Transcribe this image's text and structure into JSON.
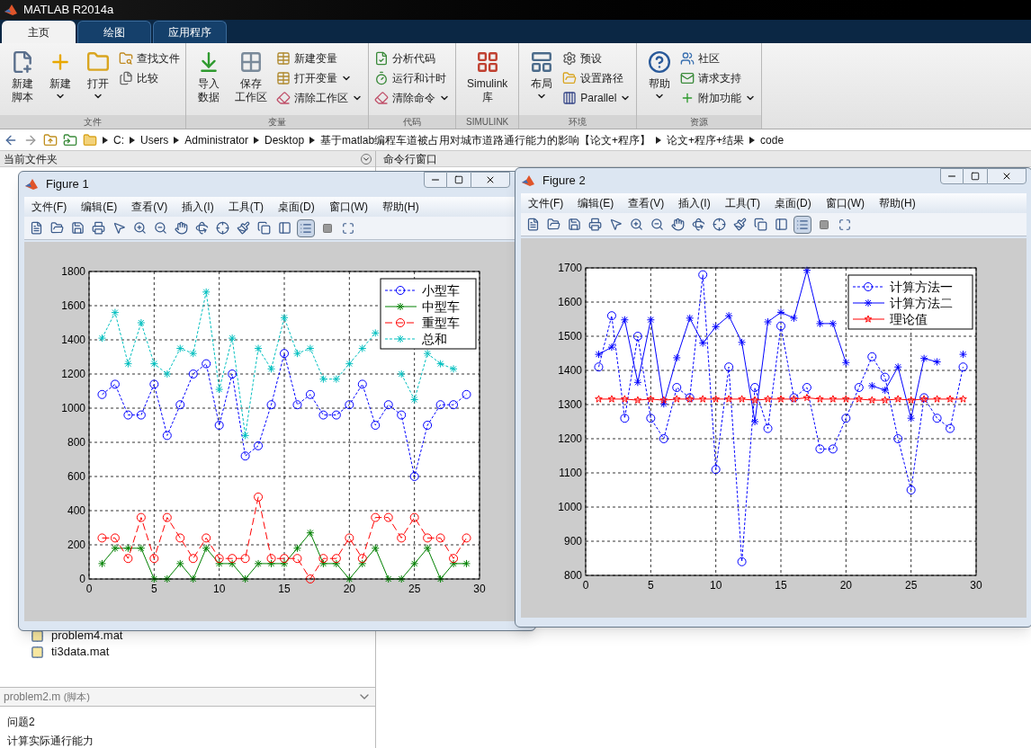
{
  "window": {
    "title": "MATLAB R2014a"
  },
  "ribbon_tabs": [
    {
      "label": "主页",
      "selected": true
    },
    {
      "label": "绘图",
      "selected": false
    },
    {
      "label": "应用程序",
      "selected": false
    }
  ],
  "ribbon_groups": [
    {
      "label": "文件",
      "items": [
        {
          "kind": "large",
          "lines": [
            "新建",
            "脚本"
          ],
          "dropdown": false
        },
        {
          "kind": "large",
          "lines": [
            "新建"
          ],
          "dropdown": true
        },
        {
          "kind": "large",
          "lines": [
            "打开"
          ],
          "dropdown": true
        },
        {
          "kind": "small",
          "lines": [
            "查找文件"
          ],
          "dropdown": false
        },
        {
          "kind": "small",
          "lines": [
            "比较"
          ],
          "dropdown": false
        }
      ]
    },
    {
      "label": "变量",
      "items": [
        {
          "kind": "large",
          "lines": [
            "导入",
            "数据"
          ],
          "dropdown": false
        },
        {
          "kind": "large",
          "lines": [
            "保存",
            "工作区"
          ],
          "dropdown": false
        },
        {
          "kind": "small",
          "lines": [
            "新建变量"
          ],
          "dropdown": false
        },
        {
          "kind": "small",
          "lines": [
            "打开变量"
          ],
          "dropdown": true
        },
        {
          "kind": "small",
          "lines": [
            "清除工作区"
          ],
          "dropdown": true
        }
      ]
    },
    {
      "label": "代码",
      "items": [
        {
          "kind": "small",
          "lines": [
            "分析代码"
          ],
          "dropdown": false
        },
        {
          "kind": "small",
          "lines": [
            "运行和计时"
          ],
          "dropdown": false
        },
        {
          "kind": "small",
          "lines": [
            "清除命令"
          ],
          "dropdown": true
        }
      ]
    },
    {
      "label": "SIMULINK",
      "items": [
        {
          "kind": "large",
          "lines": [
            "Simulink",
            "库"
          ],
          "dropdown": false
        }
      ]
    },
    {
      "label": "环境",
      "items": [
        {
          "kind": "large",
          "lines": [
            "布局"
          ],
          "dropdown": true
        },
        {
          "kind": "small",
          "lines": [
            "预设"
          ],
          "dropdown": false
        },
        {
          "kind": "small",
          "lines": [
            "设置路径"
          ],
          "dropdown": false
        },
        {
          "kind": "small",
          "lines": [
            "Parallel"
          ],
          "dropdown": true
        }
      ]
    },
    {
      "label": "资源",
      "items": [
        {
          "kind": "large",
          "lines": [
            "帮助"
          ],
          "dropdown": true
        },
        {
          "kind": "small",
          "lines": [
            "社区"
          ],
          "dropdown": false
        },
        {
          "kind": "small",
          "lines": [
            "请求支持"
          ],
          "dropdown": false
        },
        {
          "kind": "small",
          "lines": [
            "附加功能"
          ],
          "dropdown": true
        }
      ]
    }
  ],
  "address_bar": {
    "path": [
      "C:",
      "Users",
      "Administrator",
      "Desktop",
      "基于matlab编程车道被占用对城市道路通行能力的影响【论文+程序】",
      "论文+程序+结果",
      "code"
    ]
  },
  "current_folder": {
    "title": "当前文件夹",
    "files": [
      "problem4.mat",
      "ti3data.mat"
    ],
    "details": {
      "file": "problem2.m",
      "type": "(脚本)",
      "lines": [
        "问题2",
        "计算实际通行能力"
      ]
    }
  },
  "command_window": {
    "title": "命令行窗口"
  },
  "figures": [
    {
      "title": "Figure 1",
      "menu": [
        "文件(F)",
        "编辑(E)",
        "查看(V)",
        "插入(I)",
        "工具(T)",
        "桌面(D)",
        "窗口(W)",
        "帮助(H)"
      ],
      "legend_on": true,
      "chart_data": {
        "type": "line",
        "grid": true,
        "legend": true,
        "x": [
          1,
          2,
          3,
          4,
          5,
          6,
          7,
          8,
          9,
          10,
          11,
          12,
          13,
          14,
          15,
          16,
          17,
          18,
          19,
          20,
          21,
          22,
          23,
          24,
          25,
          26,
          27,
          28,
          29
        ],
        "xlim": [
          0,
          30
        ],
        "ylim": [
          0,
          1800
        ],
        "xticks": [
          0,
          5,
          10,
          15,
          20,
          25,
          30
        ],
        "yticks": [
          0,
          200,
          400,
          600,
          800,
          1000,
          1200,
          1400,
          1600,
          1800
        ],
        "series": [
          {
            "name": "小型车",
            "color": "#0000ff",
            "marker": "circle",
            "line_style": "dotted",
            "values": [
              1080,
              1140,
              960,
              960,
              1140,
              840,
              1020,
              1200,
              1260,
              900,
              1200,
              720,
              780,
              1020,
              1320,
              1020,
              1080,
              960,
              960,
              1020,
              1140,
              900,
              1020,
              960,
              600,
              900,
              1020,
              1020,
              1080
            ]
          },
          {
            "name": "中型车",
            "color": "#008000",
            "marker": "cross",
            "line_style": "solid",
            "values": [
              90,
              180,
              180,
              180,
              0,
              0,
              90,
              0,
              180,
              90,
              90,
              0,
              90,
              90,
              90,
              180,
              270,
              90,
              90,
              0,
              90,
              180,
              0,
              0,
              90,
              180,
              0,
              90,
              90
            ]
          },
          {
            "name": "重型车",
            "color": "#ff0000",
            "marker": "circle",
            "line_style": "dashed",
            "values": [
              240,
              240,
              120,
              360,
              120,
              360,
              240,
              120,
              240,
              120,
              120,
              120,
              480,
              120,
              120,
              120,
              0,
              120,
              120,
              240,
              120,
              360,
              360,
              240,
              360,
              240,
              240,
              120,
              240
            ]
          },
          {
            "name": "总和",
            "color": "#00bfbf",
            "marker": "cross",
            "line_style": "dotted",
            "values": [
              1410,
              1560,
              1260,
              1500,
              1260,
              1200,
              1350,
              1320,
              1680,
              1110,
              1410,
              840,
              1350,
              1230,
              1530,
              1320,
              1350,
              1170,
              1170,
              1260,
              1350,
              1440,
              null,
              1200,
              1050,
              1320,
              1260,
              1230,
              null
            ]
          }
        ]
      }
    },
    {
      "title": "Figure 2",
      "menu": [
        "文件(F)",
        "编辑(E)",
        "查看(V)",
        "插入(I)",
        "工具(T)",
        "桌面(D)",
        "窗口(W)",
        "帮助(H)"
      ],
      "legend_on": true,
      "chart_data": {
        "type": "line",
        "grid": true,
        "legend": true,
        "x": [
          1,
          2,
          3,
          4,
          5,
          6,
          7,
          8,
          9,
          10,
          11,
          12,
          13,
          14,
          15,
          16,
          17,
          18,
          19,
          20,
          21,
          22,
          23,
          24,
          25,
          26,
          27,
          28,
          29
        ],
        "xlim": [
          0,
          30
        ],
        "ylim": [
          800,
          1700
        ],
        "xticks": [
          0,
          5,
          10,
          15,
          20,
          25,
          30
        ],
        "yticks": [
          800,
          900,
          1000,
          1100,
          1200,
          1300,
          1400,
          1500,
          1600,
          1700
        ],
        "series": [
          {
            "name": "计算方法一",
            "color": "#0000ff",
            "marker": "circle",
            "line_style": "dotted",
            "values": [
              1410,
              1560,
              1260,
              1500,
              1260,
              1200,
              1350,
              1320,
              1680,
              1110,
              1410,
              840,
              1350,
              1230,
              1530,
              1320,
              1350,
              1170,
              1170,
              1260,
              1350,
              1440,
              1380,
              1200,
              1050,
              1320,
              1260,
              1230,
              1410
            ]
          },
          {
            "name": "计算方法二",
            "color": "#0000ff",
            "marker": "cross",
            "line_style": "solid",
            "values": [
              1447,
              1468,
              1548,
              1365,
              1548,
              1302,
              1437,
              1553,
              1480,
              1528,
              1560,
              1482,
              1250,
              1542,
              1570,
              1553,
              1693,
              1537,
              1537,
              1423,
              null,
              1355,
              1342,
              1410,
              1260,
              1435,
              1425,
              null,
              1447
            ]
          },
          {
            "name": "理论值",
            "color": "#ff0000",
            "marker": "star",
            "line_style": "solid",
            "values": [
              1316,
              1316,
              1316,
              1313,
              1316,
              1313,
              1316,
              1316,
              1316,
              1316,
              1316,
              1316,
              1313,
              1316,
              1316,
              1316,
              1320,
              1316,
              1316,
              1316,
              1316,
              1313,
              1313,
              1316,
              1313,
              1316,
              1316,
              1316,
              1316
            ]
          }
        ]
      }
    }
  ]
}
